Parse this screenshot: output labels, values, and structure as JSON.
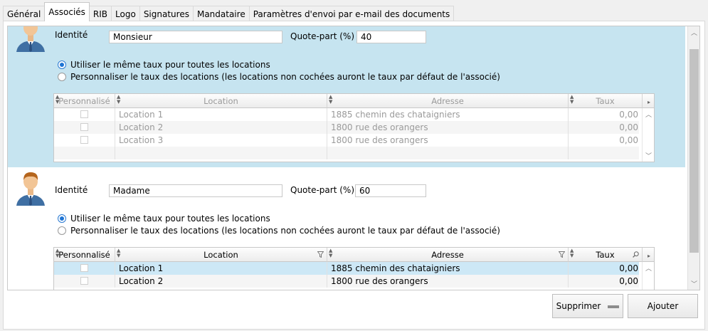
{
  "tabs": [
    "Général",
    "Associés",
    "RIB",
    "Logo",
    "Signatures",
    "Mandataire",
    "Paramètres d'envoi par e-mail des documents"
  ],
  "active_tab": "Associés",
  "labels": {
    "identite": "Identité",
    "quote_part": "Quote-part (%)",
    "radio_same": "Utiliser le même taux pour toutes les locations",
    "radio_custom": "Personnaliser le taux des locations (les locations non cochées auront le taux par défaut de l'associé)"
  },
  "grid_headers": {
    "personnalise": "Personnalisé",
    "location": "Location",
    "adresse": "Adresse",
    "taux": "Taux"
  },
  "associates": [
    {
      "identite": "Monsieur",
      "quote_part": "40",
      "rows": [
        {
          "location": "Location 1",
          "adresse": "1885 chemin des chataigniers",
          "taux": "0,00"
        },
        {
          "location": "Location 2",
          "adresse": "1800 rue des orangers",
          "taux": "0,00"
        },
        {
          "location": "Location 3",
          "adresse": "1800 rue des orangers",
          "taux": "0,00"
        }
      ]
    },
    {
      "identite": "Madame",
      "quote_part": "60",
      "rows": [
        {
          "location": "Location 1",
          "adresse": "1885 chemin des chataigniers",
          "taux": "0,00"
        },
        {
          "location": "Location 2",
          "adresse": "1800 rue des orangers",
          "taux": "0,00"
        }
      ]
    }
  ],
  "buttons": {
    "supprimer": "Supprimer",
    "ajouter": "Ajouter"
  },
  "colors": {
    "selected_bg": "#c6e4f0",
    "row_highlight": "#cde8f6",
    "radio_accent": "#1e74d4"
  }
}
